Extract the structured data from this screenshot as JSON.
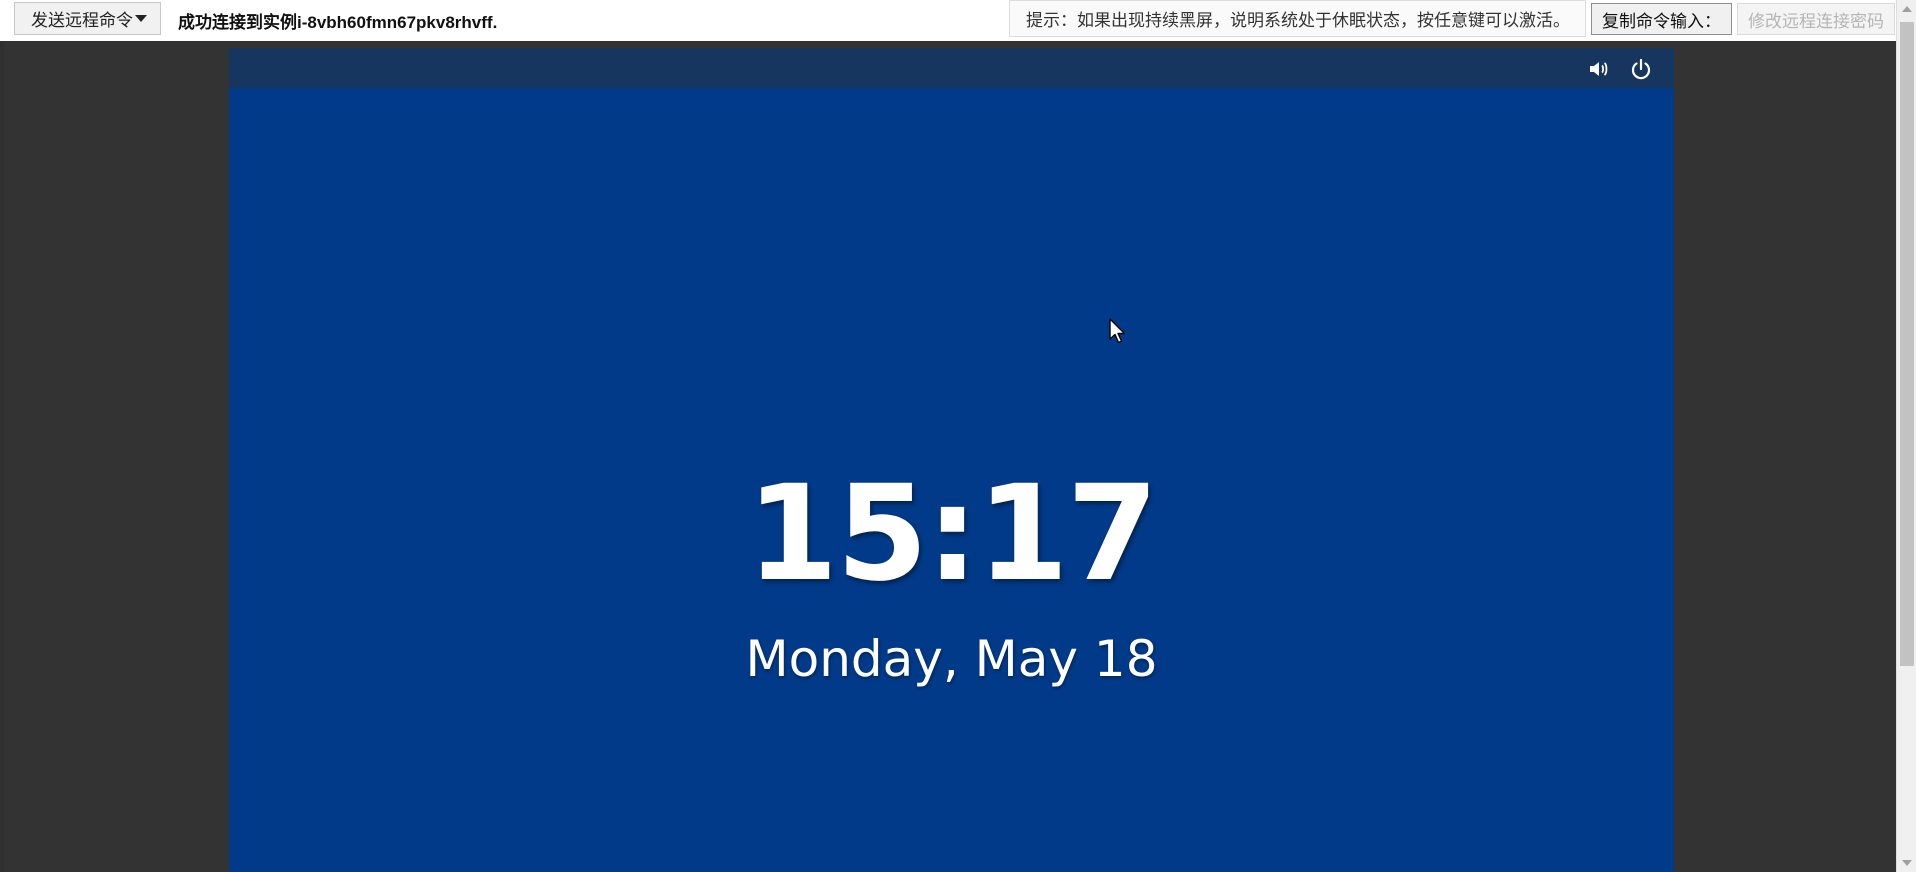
{
  "toolbar": {
    "send_command_label": "发送远程命令",
    "connection_status": "成功连接到实例i-8vbh60fmn67pkv8rhvff.",
    "hint_text": "提示：如果出现持续黑屏，说明系统处于休眠状态，按任意键可以激活。",
    "copy_command_label": "复制命令输入：",
    "change_password_label": "修改远程连接密码"
  },
  "remote_screen": {
    "icons": [
      "volume-icon",
      "power-icon"
    ],
    "time": "15:17",
    "date": "Monday, May 18"
  },
  "colors": {
    "screen_background": "#013a89",
    "top_bar_background": "#17365f",
    "viewport_background": "#333333"
  }
}
